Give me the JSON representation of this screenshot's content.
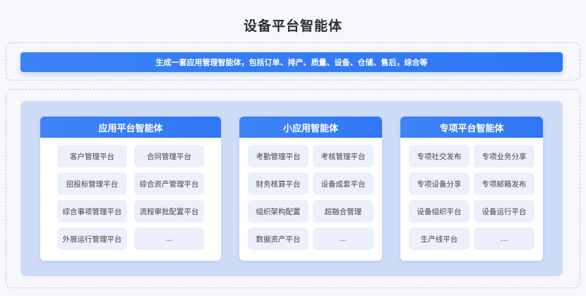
{
  "title": "设备平台智能体",
  "banner": "生成一套应用管理智能体，包括订单、排产、质量、设备、仓储、售后，综合等",
  "cards": [
    {
      "title": "应用平台智能体",
      "items": [
        "客户管理平台",
        "合同管理平台",
        "招投标管理平台",
        "综合资产管理平台",
        "综合事项管理平台",
        "流程审批配置平台",
        "外展运行管理平台",
        "..."
      ]
    },
    {
      "title": "小应用智能体",
      "items": [
        "考勤管理平台",
        "考核管理平台",
        "财务核算平台",
        "设备成套平台",
        "组织架构配置",
        "超融合管理",
        "数据资产平台",
        "..."
      ]
    },
    {
      "title": "专项平台智能体",
      "items": [
        "专项社交发布",
        "专项业务分享",
        "专项设备分享",
        "专项邮箱发布",
        "设备组织平台",
        "设备运行平台",
        "生产线平台",
        "..."
      ]
    }
  ]
}
